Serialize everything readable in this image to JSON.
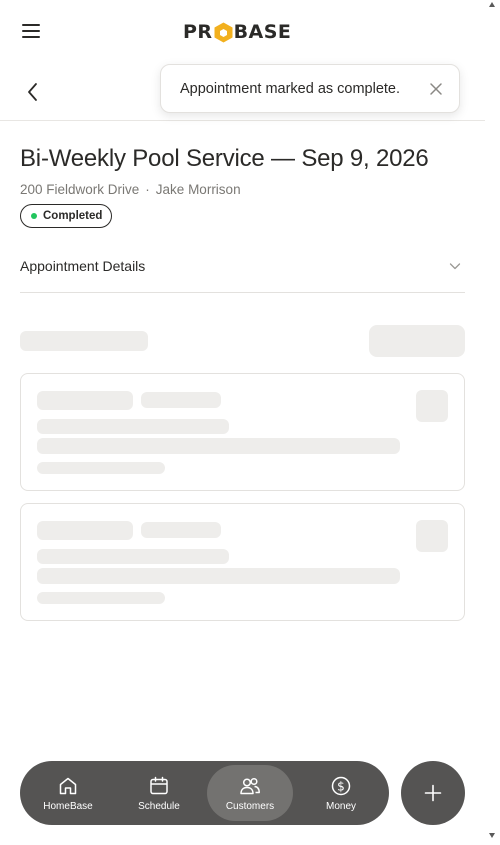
{
  "header": {
    "logo_text": "PROBASE",
    "logo_icon": "hexagon-o-icon",
    "menu_icon": "hamburger-menu-icon",
    "back_icon": "chevron-left-icon"
  },
  "toast": {
    "message": "Appointment marked as complete.",
    "close_icon": "close-icon"
  },
  "appointment": {
    "title": "Bi-Weekly Pool Service — Sep 9, 2026",
    "address": "200 Fieldwork Drive",
    "separator": "·",
    "technician": "Jake Morrison",
    "status": "Completed",
    "status_color": "#22c55e"
  },
  "details": {
    "label": "Appointment Details",
    "icon": "chevron-down-icon"
  },
  "bottom_nav": {
    "items": [
      {
        "label": "HomeBase",
        "icon": "home-icon",
        "active": false
      },
      {
        "label": "Schedule",
        "icon": "calendar-icon",
        "active": false
      },
      {
        "label": "Customers",
        "icon": "users-icon",
        "active": true
      },
      {
        "label": "Money",
        "icon": "dollar-circle-icon",
        "active": false
      }
    ],
    "add_icon": "plus-icon"
  },
  "colors": {
    "text": "#2b2a28",
    "muted": "#7a7874",
    "nav_bg": "#555453",
    "nav_active": "#737270",
    "skeleton": "#eeedeb",
    "logo_accent": "#f2b01e"
  }
}
